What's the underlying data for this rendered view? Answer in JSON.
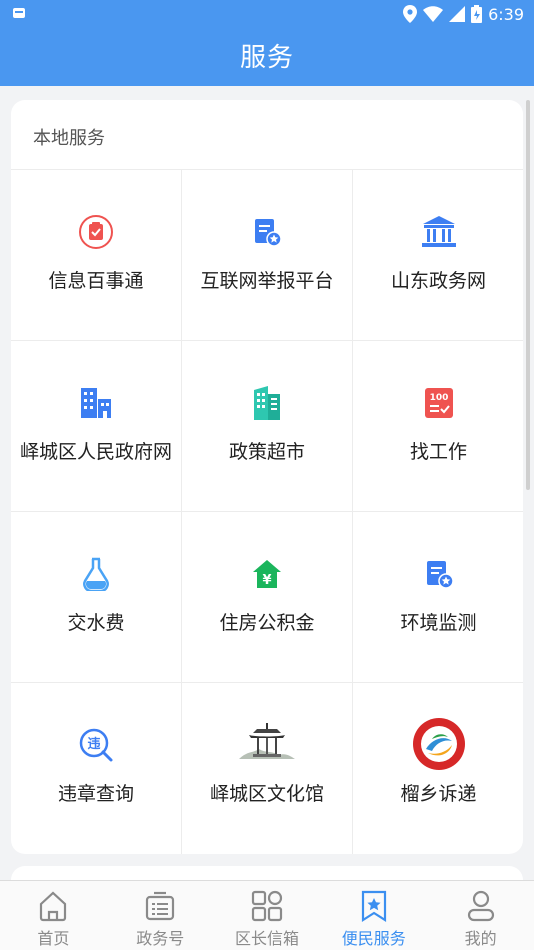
{
  "status_bar": {
    "time": "6:39"
  },
  "header": {
    "title": "服务"
  },
  "section": {
    "title": "本地服务",
    "items": [
      {
        "label": "信息百事通",
        "icon": "clipboard-check-icon"
      },
      {
        "label": "互联网举报平台",
        "icon": "document-star-icon"
      },
      {
        "label": "山东政务网",
        "icon": "government-building-icon"
      },
      {
        "label": "峄城区人民政府网",
        "icon": "city-buildings-icon"
      },
      {
        "label": "政策超市",
        "icon": "office-building-icon"
      },
      {
        "label": "找工作",
        "icon": "score-list-icon"
      },
      {
        "label": "交水费",
        "icon": "water-flask-icon"
      },
      {
        "label": "住房公积金",
        "icon": "house-yuan-icon"
      },
      {
        "label": "环境监测",
        "icon": "document-star-icon"
      },
      {
        "label": "违章查询",
        "icon": "violation-search-icon"
      },
      {
        "label": "峄城区文化馆",
        "icon": "pavilion-icon"
      },
      {
        "label": "榴乡诉递",
        "icon": "round-emblem-icon"
      }
    ],
    "colors": {
      "red": "#ef5350",
      "blue": "#3d7ef2",
      "teal": "#2ec7b0",
      "green": "#1bb55c",
      "sky": "#4aa3f5"
    }
  },
  "tabs": [
    {
      "label": "首页",
      "icon": "home-icon",
      "active": false
    },
    {
      "label": "政务号",
      "icon": "list-box-icon",
      "active": false
    },
    {
      "label": "区长信箱",
      "icon": "grid-apps-icon",
      "active": false
    },
    {
      "label": "便民服务",
      "icon": "bookmark-star-icon",
      "active": true
    },
    {
      "label": "我的",
      "icon": "person-icon",
      "active": false
    }
  ]
}
